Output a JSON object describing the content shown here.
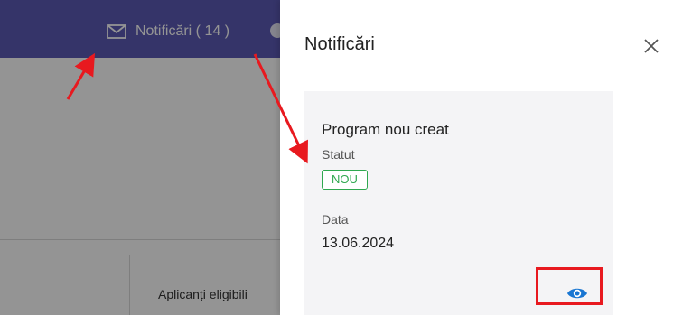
{
  "topbar": {
    "notifications_label": "Notificări ( 14 )",
    "mail_icon": "mail-icon"
  },
  "table": {
    "column_header": "Aplicanți eligibili"
  },
  "drawer": {
    "title": "Notificări",
    "close_icon": "close-icon",
    "notification": {
      "title": "Program nou creat",
      "status_label": "Statut",
      "status_value": "NOU",
      "date_label": "Data",
      "date_value": "13.06.2024",
      "view_icon": "eye-icon"
    }
  },
  "colors": {
    "topbar": "#5c5ab5",
    "badge": "#2fa84f",
    "accent": "#1976d2",
    "annotation": "#e8191f"
  }
}
